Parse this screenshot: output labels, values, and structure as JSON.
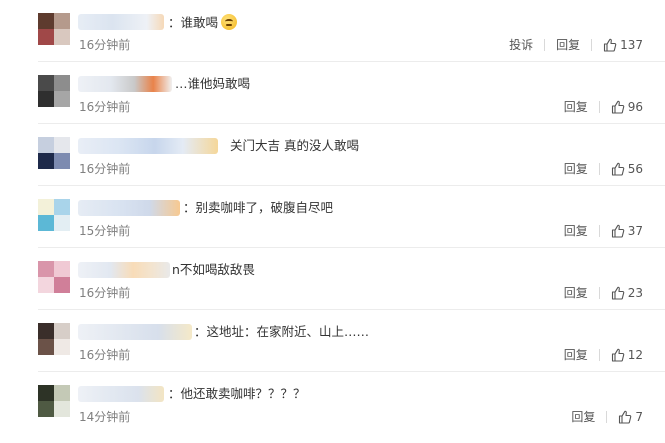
{
  "comments": [
    {
      "text": "：谁敢喝",
      "has_emoji": true,
      "emoji_name": "thinking-emoji",
      "time": "16分钟前",
      "report_label": "投诉",
      "reply_label": "回复",
      "likes": "137"
    },
    {
      "text": "…谁他妈敢喝",
      "time": "16分钟前",
      "reply_label": "回复",
      "likes": "96"
    },
    {
      "text": "关门大吉 真的没人敢喝",
      "time": "16分钟前",
      "reply_label": "回复",
      "likes": "56"
    },
    {
      "text": "：别卖咖啡了，破腹自尽吧",
      "time": "15分钟前",
      "reply_label": "回复",
      "likes": "37"
    },
    {
      "text": "n不如喝敌敌畏",
      "time": "16分钟前",
      "reply_label": "回复",
      "likes": "23"
    },
    {
      "text": "：这地址：在家附近、山上……",
      "time": "16分钟前",
      "reply_label": "回复",
      "likes": "12"
    },
    {
      "text": "：他还敢卖咖啡？？？？",
      "time": "14分钟前",
      "reply_label": "回复",
      "likes": "7"
    }
  ],
  "colors": {
    "text": "#333333",
    "time": "#808080",
    "divider": "#ececec"
  },
  "icons": {
    "like": "thumbs-up-icon"
  }
}
